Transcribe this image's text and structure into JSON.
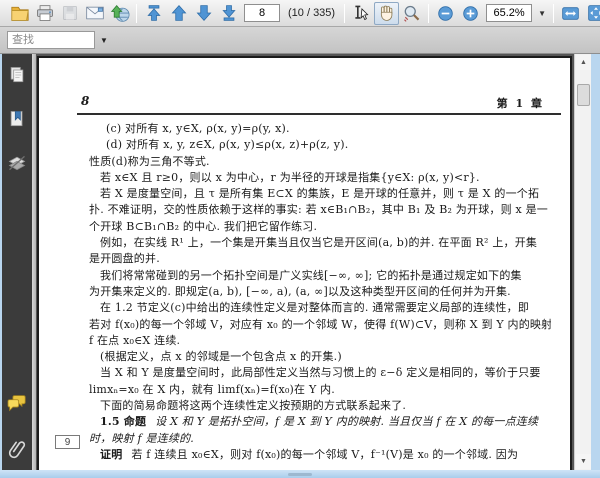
{
  "toolbar": {
    "page_input": "8",
    "page_indicator": "(10 / 335)",
    "zoom_level": "65.2%",
    "icon_names": [
      "open-folder",
      "print",
      "save",
      "email",
      "share-upload",
      "first-page",
      "previous-page",
      "next-page",
      "last-page",
      "select-text-tool",
      "hand-tool",
      "zoom-marquee-tool",
      "zoom-out",
      "zoom-in",
      "fit-width",
      "fit-page"
    ],
    "colors": {
      "accent_blue": "#4f94d4",
      "folder_yellow": "#f2c14b",
      "share_green": "#4caf50"
    }
  },
  "find_bar": {
    "placeholder": "查找"
  },
  "sidebar": {
    "icon_names": [
      "pages-panel",
      "bookmarks-panel",
      "layers-panel",
      "comments-panel",
      "attachments-panel"
    ],
    "background": "#3b3b3b"
  },
  "scrollbar": {
    "up_glyph": "▲",
    "down_glyph": "▼"
  },
  "document": {
    "header_left": "8",
    "header_right": "第 1 章",
    "margin_page_label": "9",
    "lines": [
      {
        "text": "(c) 对所有 x, y∈X, ρ(x, y)=ρ(y, x)."
      },
      {
        "text": "(d) 对所有 x, y, z∈X, ρ(x, y)≤ρ(x, z)+ρ(z, y)."
      },
      {
        "text": "性质(d)称为三角不等式."
      },
      {
        "text": "若 x∈X 且 r≥0，则以 x 为中心，r 为半径的开球是指集{y∈X: ρ(x, y)<r}."
      },
      {
        "text": "若 X 是度量空间，且 τ 是所有集 E⊂X 的集族，E 是开球的任意并，则 τ 是 X 的一个拓"
      },
      {
        "text": "扑. 不难证明，交的性质依赖于这样的事实: 若 x∈B₁∩B₂，其中 B₁ 及 B₂ 为开球，则 x 是一"
      },
      {
        "text": "个开球 B⊂B₁∩B₂ 的中心. 我们把它留作练习."
      },
      {
        "text": "例如，在实线 R¹ 上，一个集是开集当且仅当它是开区间(a, b)的并. 在平面 R² 上，开集"
      },
      {
        "text": "是开圆盘的并."
      },
      {
        "text": "我们将常常碰到的另一个拓扑空间是广义实线[−∞, ∞]; 它的拓扑是通过规定如下的集"
      },
      {
        "text": "为开集来定义的. 即规定(a, b), [−∞, a), (a, ∞]以及这种类型开区间的任何并为开集."
      },
      {
        "text": "在 1.2 节定义(c)中给出的连续性定义是对整体而言的. 通常需要定义局部的连续性，即"
      },
      {
        "text": "若对 f(x₀)的每一个邻域 V，对应有 x₀ 的一个邻域 W，使得 f(W)⊂V，则称 X 到 Y 内的映射"
      },
      {
        "text": "f 在点 x₀∈X 连续."
      },
      {
        "text": "(根据定义，点 x 的邻域是一个包含点 x 的开集.)"
      },
      {
        "text": "当 X 和 Y 是度量空间时，此局部性定义当然与习惯上的 ε−δ 定义是相同的，等价于只要"
      },
      {
        "text": "limxₙ=x₀ 在 X 内，就有 limf(xₙ)=f(x₀)在 Y 内."
      },
      {
        "text": "下面的简易命题将这两个连续性定义按预期的方式联系起来了."
      }
    ],
    "proposition": {
      "label": "1.5 命题",
      "line1": "设 X 和 Y 是拓扑空间，f 是 X 到 Y 内的映射. 当且仅当 f 在 X 的每一点连续",
      "line2": "时，映射 f 是连续的."
    },
    "proof": {
      "label": "证明",
      "text": "若 f 连续且 x₀∈X，则对 f(x₀)的每一个邻域 V，f⁻¹(V)是 x₀ 的一个邻域. 因为"
    }
  }
}
